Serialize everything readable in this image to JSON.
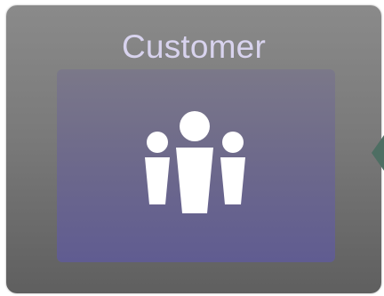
{
  "node": {
    "title": "Customer",
    "icon": "people-group-icon"
  },
  "colors": {
    "card_top": "#8a8a8a",
    "card_bottom": "#5f5f5f",
    "title_text": "#d8d3ee",
    "panel_top": "#7b7889",
    "panel_bottom": "#605c91",
    "icon_fill": "#ffffff",
    "connector": "#4e6e63"
  }
}
